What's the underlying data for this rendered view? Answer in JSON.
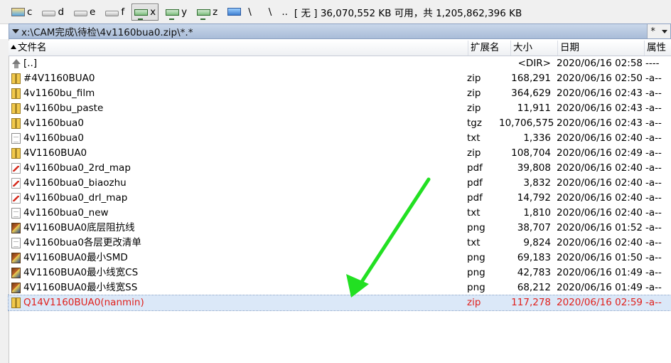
{
  "drivebar": {
    "drives": [
      {
        "letter": "c",
        "icon": "system-drive-icon"
      },
      {
        "letter": "d",
        "icon": "hard-drive-icon"
      },
      {
        "letter": "e",
        "icon": "hard-drive-icon"
      },
      {
        "letter": "f",
        "icon": "hard-drive-icon"
      },
      {
        "letter": "x",
        "icon": "network-drive-icon"
      },
      {
        "letter": "y",
        "icon": "network-drive-icon"
      },
      {
        "letter": "z",
        "icon": "network-drive-icon"
      }
    ],
    "root_label": "\\",
    "root2_label": "\\",
    "parent_label": "..",
    "free_info": "[ 无 ]  36,070,552 KB 可用，共 1,205,862,396 KB"
  },
  "pathbar": {
    "path": "x:\\CAM完成\\待检\\4v1160bua0.zip\\*.*",
    "filter": "*"
  },
  "header": {
    "name": "文件名",
    "ext": "扩展名",
    "size": "大小",
    "date": "日期",
    "attr": "属性"
  },
  "files": [
    {
      "name": "[..]",
      "ext": "",
      "size": "<DIR>",
      "date": "2020/06/16 02:58",
      "attr": "----",
      "icon": "up"
    },
    {
      "name": "#4V1160BUA0",
      "ext": "zip",
      "size": "168,291",
      "date": "2020/06/16 02:50",
      "attr": "-a--",
      "icon": "zip"
    },
    {
      "name": "4v1160bu_film",
      "ext": "zip",
      "size": "364,629",
      "date": "2020/06/16 02:43",
      "attr": "-a--",
      "icon": "zip"
    },
    {
      "name": "4v1160bu_paste",
      "ext": "zip",
      "size": "11,911",
      "date": "2020/06/16 02:43",
      "attr": "-a--",
      "icon": "zip"
    },
    {
      "name": "4v1160bua0",
      "ext": "tgz",
      "size": "10,706,575",
      "date": "2020/06/16 02:43",
      "attr": "-a--",
      "icon": "zip"
    },
    {
      "name": "4v1160bua0",
      "ext": "txt",
      "size": "1,336",
      "date": "2020/06/16 02:40",
      "attr": "-a--",
      "icon": "txt"
    },
    {
      "name": "4V1160BUA0",
      "ext": "zip",
      "size": "108,704",
      "date": "2020/06/16 02:49",
      "attr": "-a--",
      "icon": "zip"
    },
    {
      "name": "4v1160bua0_2rd_map",
      "ext": "pdf",
      "size": "39,808",
      "date": "2020/06/16 02:40",
      "attr": "-a--",
      "icon": "pdf"
    },
    {
      "name": "4v1160bua0_biaozhu",
      "ext": "pdf",
      "size": "3,832",
      "date": "2020/06/16 02:40",
      "attr": "-a--",
      "icon": "pdf"
    },
    {
      "name": "4v1160bua0_drl_map",
      "ext": "pdf",
      "size": "14,792",
      "date": "2020/06/16 02:40",
      "attr": "-a--",
      "icon": "pdf"
    },
    {
      "name": "4v1160bua0_new",
      "ext": "txt",
      "size": "1,810",
      "date": "2020/06/16 02:40",
      "attr": "-a--",
      "icon": "txt"
    },
    {
      "name": "4V1160BUA0底层阻抗线",
      "ext": "png",
      "size": "38,707",
      "date": "2020/06/16 01:52",
      "attr": "-a--",
      "icon": "png"
    },
    {
      "name": "4v1160bua0各层更改清单",
      "ext": "txt",
      "size": "9,824",
      "date": "2020/06/16 02:40",
      "attr": "-a--",
      "icon": "txt"
    },
    {
      "name": "4V1160BUA0最小SMD",
      "ext": "png",
      "size": "69,183",
      "date": "2020/06/16 01:50",
      "attr": "-a--",
      "icon": "png"
    },
    {
      "name": "4V1160BUA0最小线宽CS",
      "ext": "png",
      "size": "42,783",
      "date": "2020/06/16 01:49",
      "attr": "-a--",
      "icon": "png"
    },
    {
      "name": "4V1160BUA0最小线宽SS",
      "ext": "png",
      "size": "68,212",
      "date": "2020/06/16 01:49",
      "attr": "-a--",
      "icon": "png"
    },
    {
      "name": "Q14V1160BUA0(nanmin)",
      "ext": "zip",
      "size": "117,278",
      "date": "2020/06/16 02:59",
      "attr": "-a--",
      "icon": "zip",
      "selected": true
    }
  ],
  "colors": {
    "selected_text": "#e0201c",
    "annotation_arrow": "#22e022"
  }
}
